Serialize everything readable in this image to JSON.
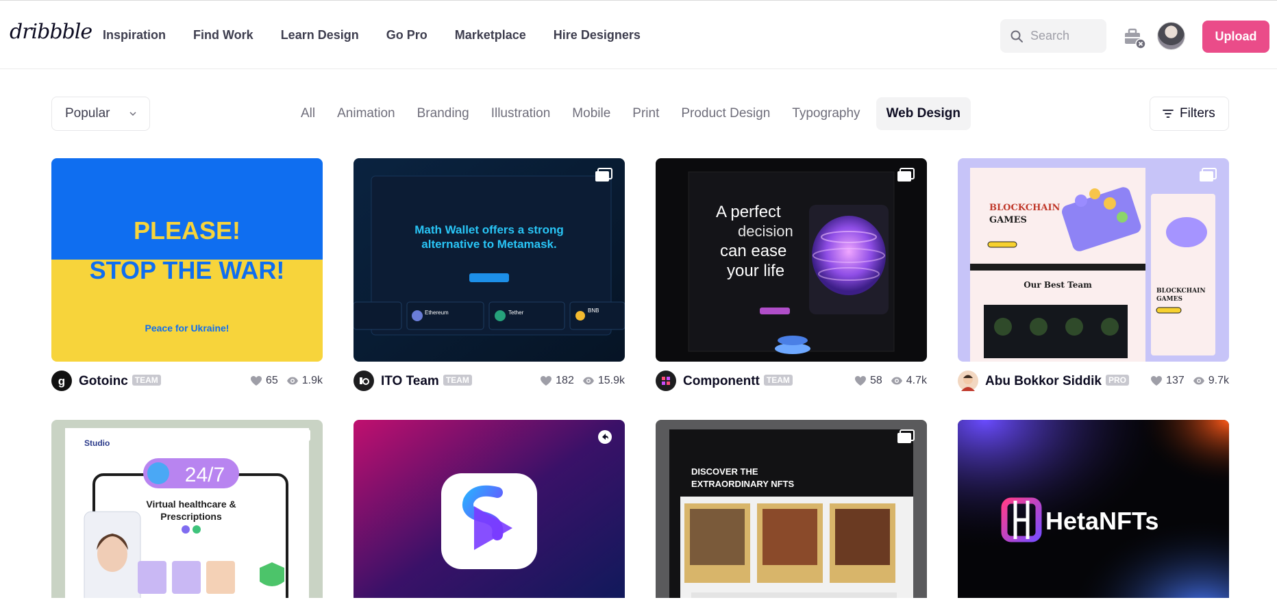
{
  "header": {
    "logo": "dribbble",
    "nav": [
      "Inspiration",
      "Find Work",
      "Learn Design",
      "Go Pro",
      "Marketplace",
      "Hire Designers"
    ],
    "search_placeholder": "Search",
    "upload_label": "Upload"
  },
  "filterbar": {
    "sort_value": "Popular",
    "categories": [
      "All",
      "Animation",
      "Branding",
      "Illustration",
      "Mobile",
      "Print",
      "Product Design",
      "Typography",
      "Web Design"
    ],
    "active_category": "Web Design",
    "filters_label": "Filters"
  },
  "shots": [
    {
      "author": "Gotoinc",
      "badge": "TEAM",
      "likes": "65",
      "views": "1.9k",
      "thumb_lines": [
        "PLEASE!",
        "STOP THE WAR!",
        "Peace for Ukraine!"
      ]
    },
    {
      "author": "ITO Team",
      "badge": "TEAM",
      "likes": "182",
      "views": "15.9k",
      "thumb_lines": [
        "Math Wallet offers a strong",
        "alternative to Metamask.",
        "Ethereum",
        "Tether",
        "BNB"
      ]
    },
    {
      "author": "Componentt",
      "badge": "TEAM",
      "likes": "58",
      "views": "4.7k",
      "thumb_lines": [
        "A perfect",
        "decision",
        "can ease",
        "your life"
      ]
    },
    {
      "author": "Abu Bokkor Siddik",
      "badge": "PRO",
      "likes": "137",
      "views": "9.7k",
      "thumb_lines": [
        "BLOCKCHAIN",
        "GAMES",
        "Our Best Team",
        "BLOCKCHAIN",
        "GAMES"
      ]
    },
    {
      "thumb_lines": [
        "Studio",
        "24/7",
        "Virtual healthcare &",
        "Prescriptions"
      ]
    },
    {
      "thumb_lines": []
    },
    {
      "thumb_lines": [
        "DISCOVER THE",
        "EXTRAORDINARY NFTS"
      ]
    },
    {
      "thumb_lines": [
        "HetaNFTs"
      ]
    }
  ],
  "colors": {
    "brand_pink": "#ea4c89",
    "ukraine_blue": "#0f6ef0",
    "ukraine_yellow": "#f7d43b"
  }
}
